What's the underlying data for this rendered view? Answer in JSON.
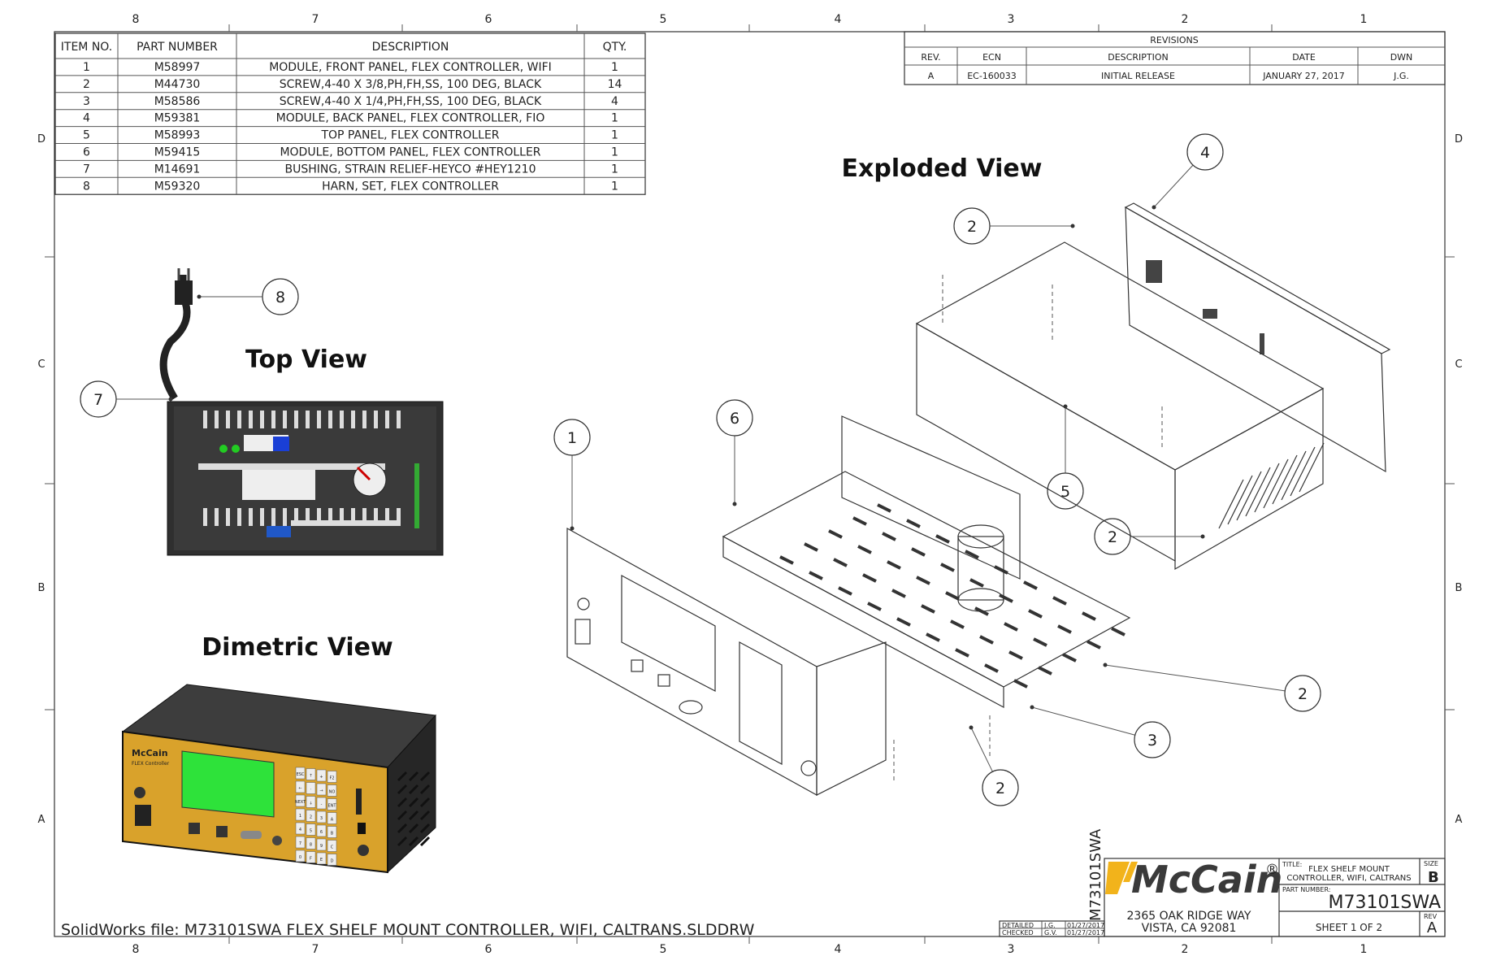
{
  "zones": {
    "columns": [
      "8",
      "7",
      "6",
      "5",
      "4",
      "3",
      "2",
      "1"
    ],
    "rows": [
      "D",
      "C",
      "B",
      "A"
    ]
  },
  "bom": {
    "headers": [
      "ITEM NO.",
      "PART NUMBER",
      "DESCRIPTION",
      "QTY."
    ],
    "rows": [
      [
        "1",
        "M58997",
        "MODULE, FRONT PANEL, FLEX CONTROLLER, WIFI",
        "1"
      ],
      [
        "2",
        "M44730",
        "SCREW,4-40 X 3/8,PH,FH,SS, 100 DEG, BLACK",
        "14"
      ],
      [
        "3",
        "M58586",
        "SCREW,4-40 X 1/4,PH,FH,SS, 100 DEG, BLACK",
        "4"
      ],
      [
        "4",
        "M59381",
        "MODULE, BACK PANEL, FLEX CONTROLLER, FIO",
        "1"
      ],
      [
        "5",
        "M58993",
        "TOP PANEL, FLEX CONTROLLER",
        "1"
      ],
      [
        "6",
        "M59415",
        "MODULE, BOTTOM PANEL, FLEX CONTROLLER",
        "1"
      ],
      [
        "7",
        "M14691",
        "BUSHING, STRAIN RELIEF-HEYCO #HEY1210",
        "1"
      ],
      [
        "8",
        "M59320",
        "HARN, SET, FLEX CONTROLLER",
        "1"
      ]
    ]
  },
  "revisions": {
    "title": "REVISIONS",
    "headers": [
      "REV.",
      "ECN",
      "DESCRIPTION",
      "DATE",
      "DWN"
    ],
    "rows": [
      [
        "A",
        "EC-160033",
        "INITIAL RELEASE",
        "JANUARY 27, 2017",
        "J.G."
      ]
    ]
  },
  "views": {
    "exploded": "Exploded View",
    "top": "Top View",
    "dimetric": "Dimetric View"
  },
  "balloons": [
    "4",
    "2",
    "8",
    "7",
    "6",
    "1",
    "5",
    "2",
    "2",
    "3",
    "2"
  ],
  "title_block": {
    "logo": "McCain",
    "registered": "®",
    "address_line1": "2365 OAK RIDGE WAY",
    "address_line2": "VISTA, CA  92081",
    "title_label": "TITLE:",
    "title_line1": "FLEX SHELF MOUNT",
    "title_line2": "CONTROLLER, WIFI, CALTRANS",
    "size_label": "SIZE",
    "size": "B",
    "part_number_label": "PART NUMBER:",
    "part_number": "M73101SWA",
    "rev_label": "REV",
    "rev": "A",
    "sheet": "SHEET 1 OF 2",
    "vertical_part_number": "M73101SWA",
    "detailed_label": "DETAILED",
    "detailed_by": "J.G.",
    "detailed_date": "01/27/2017",
    "checked_label": "CHECKED",
    "checked_by": "G.V.",
    "checked_date": "01/27/2017"
  },
  "device": {
    "brand": "McCain",
    "model": "FLEX Controller",
    "keypad": [
      "ESC",
      "↑",
      "+",
      "F2",
      "←",
      "·",
      "→",
      "NO",
      "NEXT",
      "↓",
      "-",
      "ENT",
      "1",
      "2",
      "3",
      "A",
      "4",
      "5",
      "6",
      "B",
      "7",
      "8",
      "9",
      "C",
      "0",
      "F",
      "E",
      "D"
    ]
  },
  "footer": {
    "file": "SolidWorks file:  M73101SWA FLEX SHELF MOUNT CONTROLLER, WIFI, CALTRANS.SLDDRW"
  },
  "colors": {
    "logo_yellow": "#f2b31b",
    "panel_gold": "#d9a22b",
    "screen_green": "#2ee23a",
    "chassis": "#2b2b2b"
  }
}
